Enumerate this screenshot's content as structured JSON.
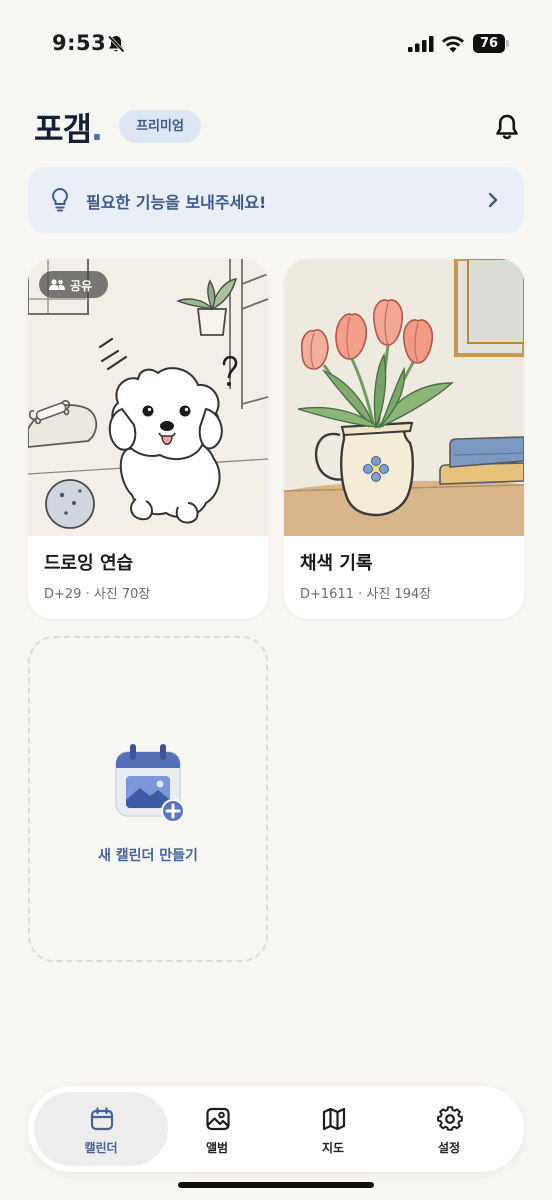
{
  "status_bar": {
    "time": "9:53",
    "battery": "76"
  },
  "header": {
    "logo_text": "포갬",
    "logo_dot": ".",
    "premium_label": "프리미엄"
  },
  "banner": {
    "text": "필요한 기능을 보내주세요!"
  },
  "calendars": [
    {
      "title": "드로잉 연습",
      "meta": "D+29 · 사진 70장",
      "badge": "공유"
    },
    {
      "title": "채색 기록",
      "meta": "D+1611 · 사진 194장"
    }
  ],
  "new_calendar": {
    "label": "새 캘린더 만들기"
  },
  "nav": {
    "items": [
      {
        "label": "캘린더",
        "icon": "calendar-icon",
        "active": true
      },
      {
        "label": "앨범",
        "icon": "album-icon",
        "active": false
      },
      {
        "label": "지도",
        "icon": "map-icon",
        "active": false
      },
      {
        "label": "설정",
        "icon": "gear-icon",
        "active": false
      }
    ]
  },
  "colors": {
    "accent": "#4562a0",
    "banner_bg": "#e9eef7",
    "premium_bg": "#dfe6f3",
    "background": "#f8f6f2"
  }
}
